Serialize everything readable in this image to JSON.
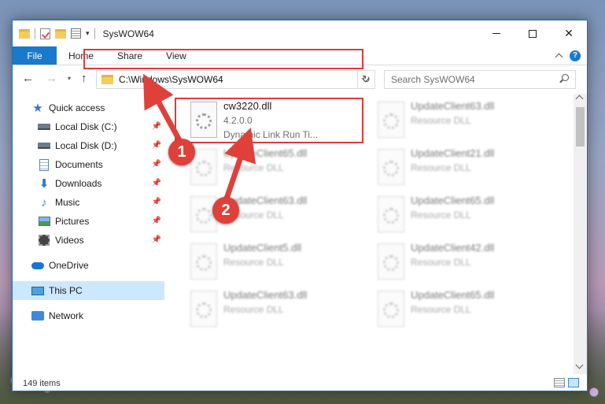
{
  "window": {
    "title": "SysWOW64",
    "controls": {
      "minimize": "minimize",
      "maximize": "maximize",
      "close": "✕"
    }
  },
  "ribbon": {
    "tabs": [
      {
        "label": "File"
      },
      {
        "label": "Home"
      },
      {
        "label": "Share"
      },
      {
        "label": "View"
      }
    ],
    "help": "?"
  },
  "nav": {
    "back": "←",
    "forward": "→",
    "up": "↑",
    "recent_dropdown": "▾",
    "address": "C:\\Windows\\SysWOW64",
    "refresh": "↻",
    "search_placeholder": "Search SysWOW64"
  },
  "sidebar": {
    "items": [
      {
        "label": "Quick access",
        "icon": "star-icon"
      },
      {
        "label": "Local Disk (C:)",
        "icon": "drive-icon",
        "pinned": true
      },
      {
        "label": "Local Disk (D:)",
        "icon": "drive-icon",
        "pinned": true
      },
      {
        "label": "Documents",
        "icon": "documents-icon",
        "pinned": true
      },
      {
        "label": "Downloads",
        "icon": "download-icon",
        "pinned": true
      },
      {
        "label": "Music",
        "icon": "music-icon",
        "pinned": true
      },
      {
        "label": "Pictures",
        "icon": "pictures-icon",
        "pinned": true
      },
      {
        "label": "Videos",
        "icon": "videos-icon",
        "pinned": true
      },
      {
        "label": "OneDrive",
        "icon": "cloud-icon"
      },
      {
        "label": "This PC",
        "icon": "pc-icon",
        "selected": true
      },
      {
        "label": "Network",
        "icon": "network-icon"
      }
    ]
  },
  "files": [
    {
      "name": "cw3220.dll",
      "version": "4.2.0.0",
      "description": "Dynamic Link Run Ti...",
      "highlighted": true
    },
    {
      "name": "UpdateClient63.dll",
      "description": "Resource DLL"
    },
    {
      "name": "UpdateClient65.dll",
      "description": "Resource DLL"
    },
    {
      "name": "UpdateClient21.dll",
      "description": "Resource DLL"
    },
    {
      "name": "UpdateClient63.dll",
      "description": "Resource DLL"
    },
    {
      "name": "UpdateClient65.dll",
      "description": "Resource DLL"
    },
    {
      "name": "UpdateClient5.dll",
      "description": "Resource DLL"
    },
    {
      "name": "UpdateClient42.dll",
      "description": "Resource DLL"
    },
    {
      "name": "UpdateClient63.dll",
      "description": "Resource DLL"
    },
    {
      "name": "UpdateClient65.dll",
      "description": "Resource DLL"
    }
  ],
  "status": {
    "count": "149 items"
  },
  "callouts": [
    {
      "label": "1"
    },
    {
      "label": "2"
    }
  ],
  "colors": {
    "accent": "#1979ca",
    "highlight": "#e03a3a",
    "selected": "#cce8ff"
  }
}
